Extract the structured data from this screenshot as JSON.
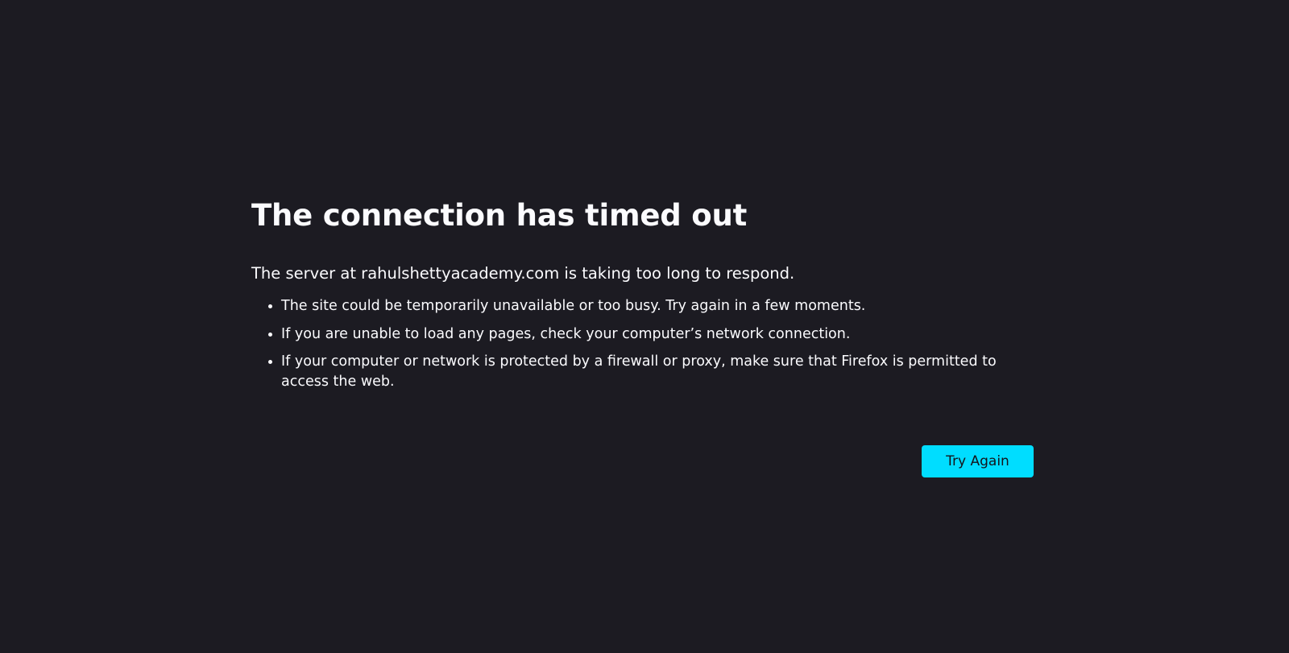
{
  "error": {
    "title": "The connection has timed out",
    "intro": "The server at rahulshettyacademy.com is taking too long to respond.",
    "suggestions": [
      "The site could be temporarily unavailable or too busy. Try again in a few moments.",
      "If you are unable to load any pages, check your computer’s network connection.",
      "If your computer or network is protected by a firewall or proxy, make sure that Firefox is permitted to access the web."
    ],
    "try_again_label": "Try Again"
  },
  "colors": {
    "background": "#1c1b22",
    "text": "#fbfbfe",
    "accent_button": "#00ddff",
    "button_text": "#15141a"
  }
}
